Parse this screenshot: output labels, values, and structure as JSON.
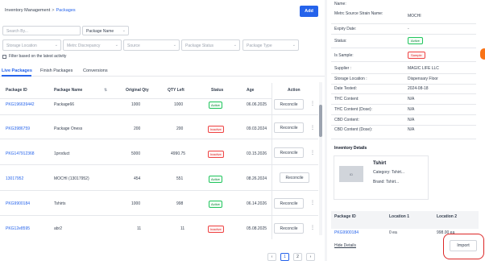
{
  "breadcrumb": {
    "root": "Inventory Management",
    "sep": ">",
    "current": "Packages"
  },
  "toolbar": {
    "add_label": "Add"
  },
  "search": {
    "placeholder": "Search By...",
    "search_by_value": "Package Name"
  },
  "filters": {
    "storage_location": "Storage Location",
    "metrc_discrepancy": "Metrc Discrepancy",
    "source": "Source",
    "package_status": "Package Status",
    "package_type": "Package Type"
  },
  "filter_latest_label": "Filter based on the latest activity",
  "tabs": [
    {
      "label": "Live Packages"
    },
    {
      "label": "Finish Packages"
    },
    {
      "label": "Conversions"
    }
  ],
  "table": {
    "headers": [
      "Package ID",
      "Package Name",
      "Original Qty",
      "QTY Left",
      "Status",
      "Age",
      "Action"
    ],
    "reconcile_label": "Reconcile",
    "rows": [
      {
        "id": "PKG196639442",
        "name": "Package66",
        "orig": "1000",
        "left": "1000",
        "status": "Active",
        "age": "06.06.2025"
      },
      {
        "id": "PKG3986759",
        "name": "Package Oness",
        "orig": "200",
        "left": "200",
        "status": "Inactive",
        "age": "09.03.2024"
      },
      {
        "id": "PKG147912368",
        "name": "1product",
        "orig": "5000",
        "left": "4990.75",
        "status": "Inactive",
        "age": "03.15.2026"
      },
      {
        "id": "13017952",
        "name": "MOCHI (13017952)",
        "orig": "454",
        "left": "551",
        "status": "Active",
        "age": "08.26.2024"
      },
      {
        "id": "PKG9900184",
        "name": "Tshirts",
        "orig": "1000",
        "left": "998",
        "status": "Active",
        "age": "06.14.2026"
      },
      {
        "id": "PKG12e8595",
        "name": "abr2",
        "orig": "11",
        "left": "11",
        "status": "Inactive",
        "age": "05.08.2025"
      }
    ]
  },
  "pagination": {
    "prev": "‹",
    "page1": "1",
    "page2": "2",
    "next": "›"
  },
  "details": {
    "name_label": "Name:",
    "metrc_label": "Metrc Source Strain Name:",
    "metrc_value": "MOCHI",
    "expiry_label": "Expiry Date:",
    "expiry_value": "-",
    "status_label": "Status:",
    "status_value": "Active",
    "sample_label": "Is Sample:",
    "sample_value": "Sample",
    "supplier_label": "Supplier :",
    "supplier_value": "MAGIC LIFE LLC",
    "storage_label": "Storage Location :",
    "storage_value": "Dispensary Floor",
    "tested_label": "Date Tested:",
    "tested_value": "2024-08-18",
    "thc_label": "THC Content:",
    "thc_value": "N/A",
    "thc_dose_label": "THC Content (Dose):",
    "thc_dose_value": "N/A",
    "cbd_label": "CBD Content:",
    "cbd_value": "N/A",
    "cbd_dose_label": "CBD Content (Dose):",
    "cbd_dose_value": "N/A"
  },
  "inventory": {
    "title": "Inventory Details",
    "thumb": "ID",
    "name": "Tshirt",
    "category": "Category: Tshirt...",
    "brand": "Brand: Tshirt..."
  },
  "locations": {
    "headers": [
      "Package ID",
      "Location 1",
      "Location 2"
    ],
    "row": [
      "PKG9900184",
      "0 ea",
      "998.00 ea"
    ]
  },
  "hide_details": "Hide Details",
  "import_label": "Import"
}
